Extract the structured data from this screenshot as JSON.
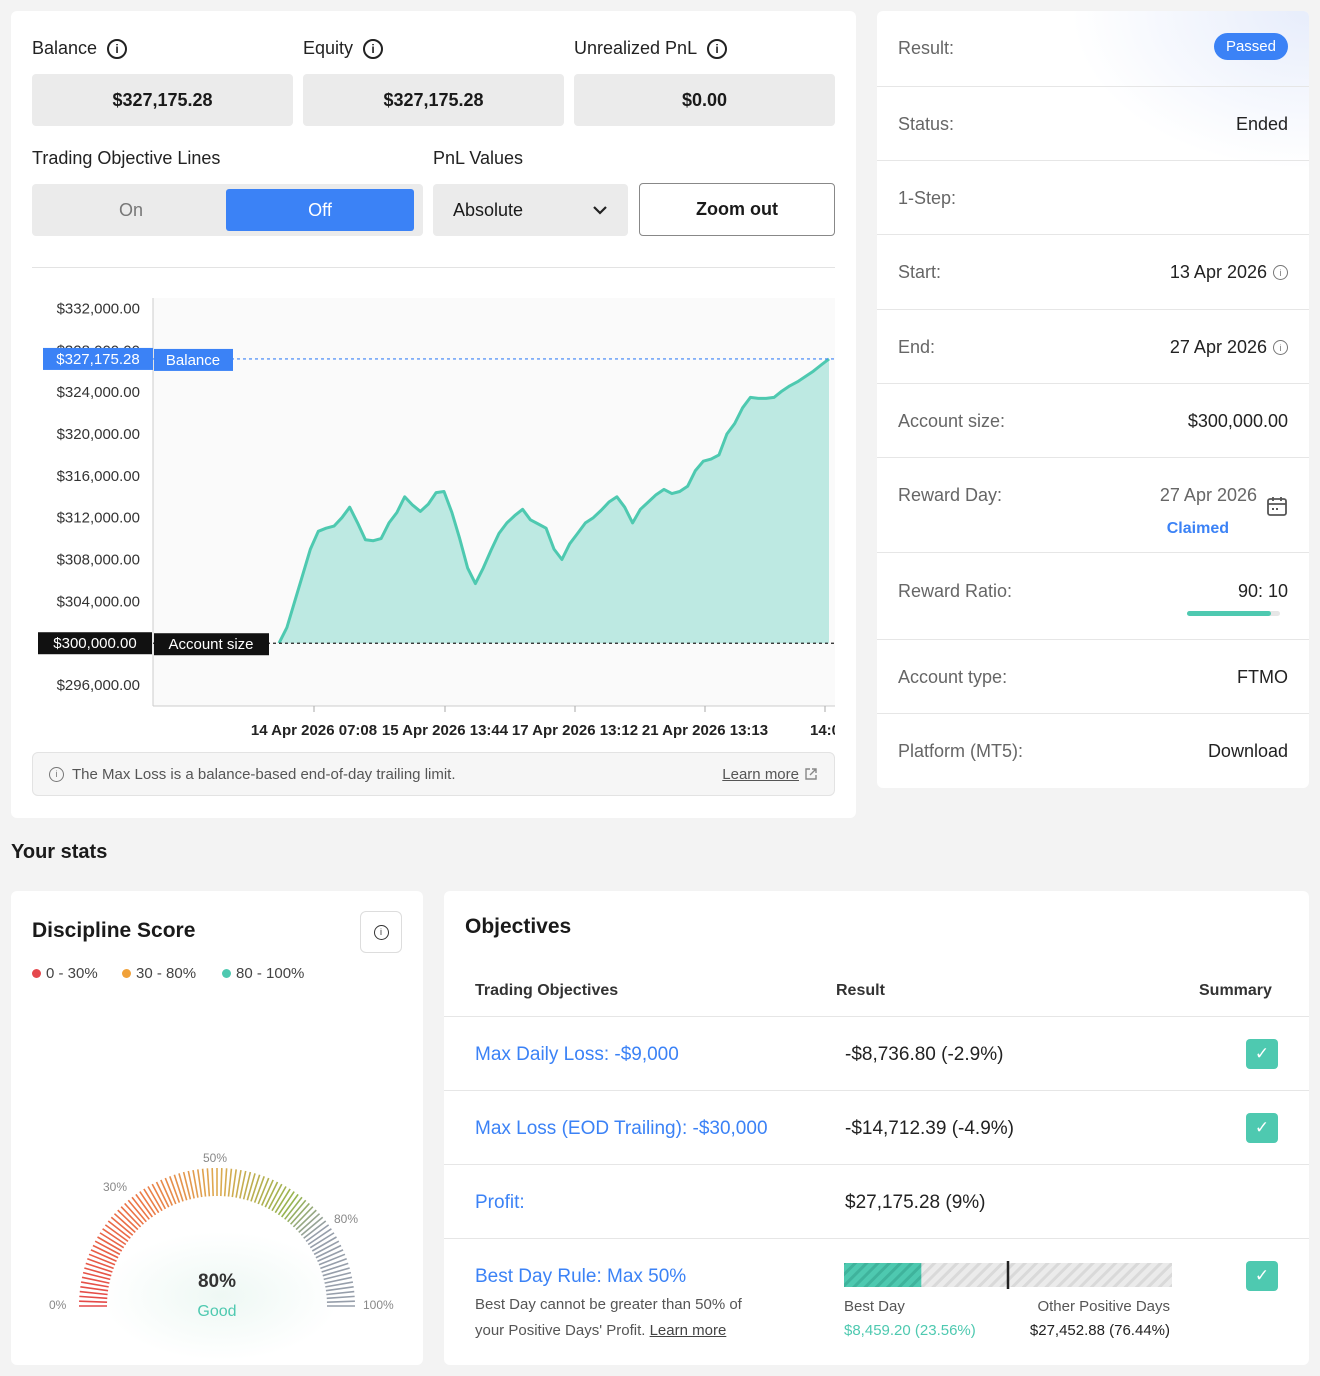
{
  "metrics": {
    "balance_label": "Balance",
    "balance_value": "$327,175.28",
    "equity_label": "Equity",
    "equity_value": "$327,175.28",
    "unrealized_label": "Unrealized PnL",
    "unrealized_value": "$0.00"
  },
  "controls": {
    "objective_lines_label": "Trading Objective Lines",
    "toggle_on": "On",
    "toggle_off": "Off",
    "pnl_label": "PnL Values",
    "pnl_selected": "Absolute",
    "zoom_out": "Zoom out"
  },
  "chart_data": {
    "type": "area",
    "y_tick_labels": [
      "$332,000.00",
      "$328,000.00",
      "$324,000.00",
      "$320,000.00",
      "$316,000.00",
      "$312,000.00",
      "$308,000.00",
      "$304,000.00",
      "$300,000.00",
      "$296,000.00"
    ],
    "y_ticks": [
      332000,
      328000,
      324000,
      320000,
      316000,
      312000,
      308000,
      304000,
      300000,
      296000
    ],
    "ylim": [
      294000,
      333000
    ],
    "x_tick_labels": [
      "14 Apr 2026 07:08",
      "15 Apr 2026 13:44",
      "17 Apr 2026 13:12",
      "21 Apr 2026 13:13",
      "14:0"
    ],
    "series": [
      {
        "values": [
          300000,
          301500,
          304000,
          306500,
          309000,
          310700,
          311000,
          311200,
          312000,
          313000,
          311500,
          309900,
          309800,
          310000,
          311500,
          312500,
          314000,
          313200,
          312600,
          313300,
          314400,
          314500,
          312500,
          310000,
          307200,
          305700,
          307200,
          308900,
          310500,
          311500,
          312200,
          312800,
          311800,
          311400,
          311000,
          309000,
          308000,
          309500,
          310500,
          311500,
          312000,
          312700,
          313500,
          314000,
          313000,
          311500,
          312800,
          313500,
          314200,
          314700,
          314300,
          314500,
          315000,
          316500,
          317400,
          317600,
          318000,
          320000,
          321000,
          322500,
          323500,
          323400,
          323400,
          323500,
          324100,
          324600,
          325000,
          325500,
          326000,
          326600,
          327175.28
        ]
      }
    ],
    "balance_value": 327175.28,
    "balance_tag": "$327,175.28",
    "balance_label": "Balance",
    "account_size_value": 300000,
    "account_size_tag": "$300,000.00",
    "account_size_label": "Account size"
  },
  "note": {
    "text": "The Max Loss is a balance-based end-of-day trailing limit.",
    "link": "Learn more"
  },
  "info": {
    "result_label": "Result:",
    "result_value": "Passed",
    "status_label": "Status:",
    "status_value": "Ended",
    "step_label": "1-Step:",
    "start_label": "Start:",
    "start_value": "13 Apr 2026",
    "end_label": "End:",
    "end_value": "27 Apr 2026",
    "account_size_label": "Account size:",
    "account_size_value": "$300,000.00",
    "reward_day_label": "Reward Day:",
    "reward_day_value": "27 Apr 2026",
    "reward_day_status": "Claimed",
    "reward_ratio_label": "Reward Ratio:",
    "reward_ratio_value": "90: 10",
    "reward_ratio_fraction": 0.9,
    "account_type_label": "Account type:",
    "account_type_value": "FTMO",
    "platform_label": "Platform (MT5):",
    "platform_value": "Download"
  },
  "stats": {
    "title": "Your stats",
    "discipline": {
      "title": "Discipline Score",
      "legend": [
        {
          "label": "0 - 30%",
          "color": "#e5484d"
        },
        {
          "label": "30 - 80%",
          "color": "#f0a13a"
        },
        {
          "label": "80 - 100%",
          "color": "#4ec9b0"
        }
      ],
      "gauge_labels": {
        "l0": "0%",
        "l30": "30%",
        "l50": "50%",
        "l80": "80%",
        "l100": "100%"
      },
      "score": 80,
      "score_text": "80%",
      "score_word": "Good"
    }
  },
  "objectives": {
    "title": "Objectives",
    "col_objective": "Trading Objectives",
    "col_result": "Result",
    "col_summary": "Summary",
    "rows": [
      {
        "name": "Max Daily Loss: -$9,000",
        "result": "-$8,736.80 (-2.9%)"
      },
      {
        "name": "Max Loss (EOD Trailing): -$30,000",
        "result": "-$14,712.39 (-4.9%)"
      },
      {
        "name": "Profit:",
        "result": "$27,175.28 (9%)"
      },
      {
        "name": "Best Day Rule: Max 50%",
        "result": ""
      }
    ],
    "best_day": {
      "desc_line1": "Best Day cannot be greater than 50% of",
      "desc_line2": "your Positive Days' Profit.",
      "desc_link": "Learn more",
      "best_label": "Best Day",
      "best_value": "$8,459.20 (23.56%)",
      "best_fraction": 0.2356,
      "limit_fraction": 0.5,
      "other_label": "Other Positive Days",
      "other_value": "$27,452.88 (76.44%)"
    },
    "check_mark": "✓"
  }
}
